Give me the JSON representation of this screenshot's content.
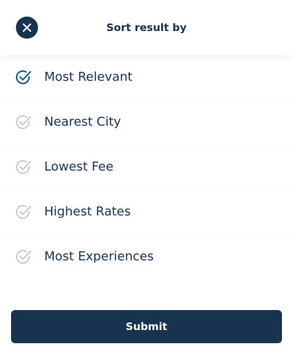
{
  "header": {
    "title": "Sort result by",
    "close_icon": "close-icon"
  },
  "options": [
    {
      "label": "Most Relevant",
      "selected": true
    },
    {
      "label": "Nearest City",
      "selected": false
    },
    {
      "label": "Lowest Fee",
      "selected": false
    },
    {
      "label": "Highest Rates",
      "selected": false
    },
    {
      "label": "Most Experiences",
      "selected": false
    }
  ],
  "submit": {
    "label": "Submit"
  },
  "colors": {
    "primary": "#17334f",
    "selected_check": "#1f5f7a",
    "unselected_check": "#c9c9c9",
    "text": "#1b3350"
  }
}
